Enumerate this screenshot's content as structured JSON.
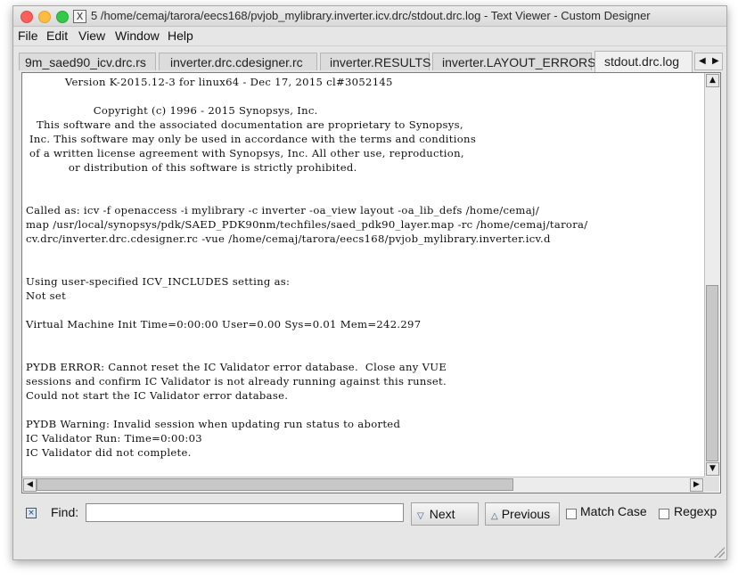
{
  "window": {
    "title": "5 /home/cemaj/tarora/eecs168/pvjob_mylibrary.inverter.icv.drc/stdout.drc.log - Text Viewer - Custom Designer",
    "app_icon": "X"
  },
  "menu": [
    "File",
    "Edit",
    "View",
    "Window",
    "Help"
  ],
  "tabs": [
    {
      "label": "9m_saed90_icv.drc.rs"
    },
    {
      "label": "inverter.drc.cdesigner.rc"
    },
    {
      "label": "inverter.RESULTS"
    },
    {
      "label": "inverter.LAYOUT_ERRORS"
    },
    {
      "label": "stdout.drc.log",
      "active": true
    }
  ],
  "log_lines": [
    "           Version K-2015.12-3 for linux64 - Dec 17, 2015 cl#3052145",
    "",
    "                   Copyright (c) 1996 - 2015 Synopsys, Inc.",
    "   This software and the associated documentation are proprietary to Synopsys,",
    " Inc. This software may only be used in accordance with the terms and conditions",
    " of a written license agreement with Synopsys, Inc. All other use, reproduction,",
    "            or distribution of this software is strictly prohibited.",
    "",
    "",
    "Called as: icv -f openaccess -i mylibrary -c inverter -oa_view layout -oa_lib_defs /home/cemaj/",
    "map /usr/local/synopsys/pdk/SAED_PDK90nm/techfiles/saed_pdk90_layer.map -rc /home/cemaj/tarora/",
    "cv.drc/inverter.drc.cdesigner.rc -vue /home/cemaj/tarora/eecs168/pvjob_mylibrary.inverter.icv.d",
    "",
    "",
    "Using user-specified ICV_INCLUDES setting as:",
    "Not set",
    "",
    "Virtual Machine Init Time=0:00:00 User=0.00 Sys=0.01 Mem=242.297",
    "",
    "",
    "PYDB ERROR: Cannot reset the IC Validator error database.  Close any VUE",
    "sessions and confirm IC Validator is not already running against this runset.",
    "Could not start the IC Validator error database.",
    "",
    "PYDB Warning: Invalid session when updating run status to aborted",
    "IC Validator Run: Time=0:00:03",
    "IC Validator did not complete."
  ],
  "find": {
    "label": "Find:",
    "value": "",
    "next_label": "Next",
    "previous_label": "Previous",
    "match_case_label": "Match Case",
    "regexp_label": "Regexp",
    "match_case_checked": false,
    "regexp_checked": false
  },
  "colors": {
    "close": "#fc605c",
    "minimize": "#fdbc40",
    "maximize": "#34c84a"
  }
}
